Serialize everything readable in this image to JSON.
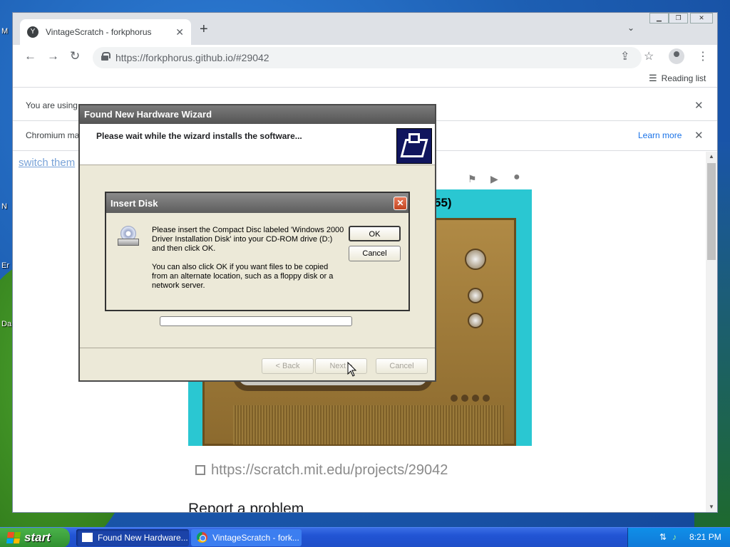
{
  "desktop": {
    "labels": [
      "M",
      "N",
      "Er",
      "Da"
    ]
  },
  "browser": {
    "tab_title": "VintageScratch - forkphorus",
    "tab_favicon": "forkphorus-icon",
    "new_tab": "+",
    "url": "https://forkphorus.github.io/#29042",
    "reading_list": "Reading list",
    "infobar1_text": "You are using",
    "infobar2_text": "Chromium ma",
    "learn_more": "Learn more"
  },
  "page": {
    "switch_theme": "switch them",
    "stage_title_fragment": "55)",
    "project_link": "https://scratch.mit.edu/projects/29042",
    "report": "Report a problem"
  },
  "wizard": {
    "title": "Found New Hardware Wizard",
    "heading": "Please wait while the wizard installs the software...",
    "back": "< Back",
    "next": "Next >",
    "cancel": "Cancel"
  },
  "insert_disk": {
    "title": "Insert Disk",
    "message1": "Please insert the Compact Disc labeled 'Windows 2000 Driver Installation Disk' into your CD-ROM drive (D:) and then click OK.",
    "message2": "You can also click OK if you want files to be copied from an alternate location, such as a floppy disk or a network server.",
    "ok": "OK",
    "cancel": "Cancel"
  },
  "taskbar": {
    "start": "start",
    "task1": "Found New Hardware...",
    "task2": "VintageScratch - fork...",
    "clock": "8:21 PM"
  }
}
